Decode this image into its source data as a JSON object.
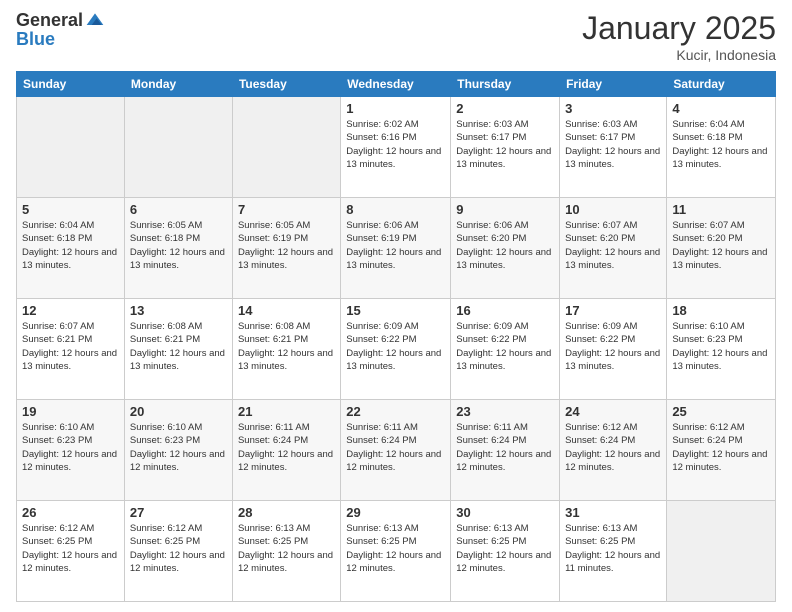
{
  "logo": {
    "general": "General",
    "blue": "Blue"
  },
  "header": {
    "month": "January 2025",
    "location": "Kucir, Indonesia"
  },
  "weekdays": [
    "Sunday",
    "Monday",
    "Tuesday",
    "Wednesday",
    "Thursday",
    "Friday",
    "Saturday"
  ],
  "weeks": [
    [
      {
        "day": "",
        "empty": true
      },
      {
        "day": "",
        "empty": true
      },
      {
        "day": "",
        "empty": true
      },
      {
        "day": "1",
        "sunrise": "6:02 AM",
        "sunset": "6:16 PM",
        "daylight": "12 hours and 13 minutes."
      },
      {
        "day": "2",
        "sunrise": "6:03 AM",
        "sunset": "6:17 PM",
        "daylight": "12 hours and 13 minutes."
      },
      {
        "day": "3",
        "sunrise": "6:03 AM",
        "sunset": "6:17 PM",
        "daylight": "12 hours and 13 minutes."
      },
      {
        "day": "4",
        "sunrise": "6:04 AM",
        "sunset": "6:18 PM",
        "daylight": "12 hours and 13 minutes."
      }
    ],
    [
      {
        "day": "5",
        "sunrise": "6:04 AM",
        "sunset": "6:18 PM",
        "daylight": "12 hours and 13 minutes."
      },
      {
        "day": "6",
        "sunrise": "6:05 AM",
        "sunset": "6:18 PM",
        "daylight": "12 hours and 13 minutes."
      },
      {
        "day": "7",
        "sunrise": "6:05 AM",
        "sunset": "6:19 PM",
        "daylight": "12 hours and 13 minutes."
      },
      {
        "day": "8",
        "sunrise": "6:06 AM",
        "sunset": "6:19 PM",
        "daylight": "12 hours and 13 minutes."
      },
      {
        "day": "9",
        "sunrise": "6:06 AM",
        "sunset": "6:20 PM",
        "daylight": "12 hours and 13 minutes."
      },
      {
        "day": "10",
        "sunrise": "6:07 AM",
        "sunset": "6:20 PM",
        "daylight": "12 hours and 13 minutes."
      },
      {
        "day": "11",
        "sunrise": "6:07 AM",
        "sunset": "6:20 PM",
        "daylight": "12 hours and 13 minutes."
      }
    ],
    [
      {
        "day": "12",
        "sunrise": "6:07 AM",
        "sunset": "6:21 PM",
        "daylight": "12 hours and 13 minutes."
      },
      {
        "day": "13",
        "sunrise": "6:08 AM",
        "sunset": "6:21 PM",
        "daylight": "12 hours and 13 minutes."
      },
      {
        "day": "14",
        "sunrise": "6:08 AM",
        "sunset": "6:21 PM",
        "daylight": "12 hours and 13 minutes."
      },
      {
        "day": "15",
        "sunrise": "6:09 AM",
        "sunset": "6:22 PM",
        "daylight": "12 hours and 13 minutes."
      },
      {
        "day": "16",
        "sunrise": "6:09 AM",
        "sunset": "6:22 PM",
        "daylight": "12 hours and 13 minutes."
      },
      {
        "day": "17",
        "sunrise": "6:09 AM",
        "sunset": "6:22 PM",
        "daylight": "12 hours and 13 minutes."
      },
      {
        "day": "18",
        "sunrise": "6:10 AM",
        "sunset": "6:23 PM",
        "daylight": "12 hours and 13 minutes."
      }
    ],
    [
      {
        "day": "19",
        "sunrise": "6:10 AM",
        "sunset": "6:23 PM",
        "daylight": "12 hours and 12 minutes."
      },
      {
        "day": "20",
        "sunrise": "6:10 AM",
        "sunset": "6:23 PM",
        "daylight": "12 hours and 12 minutes."
      },
      {
        "day": "21",
        "sunrise": "6:11 AM",
        "sunset": "6:24 PM",
        "daylight": "12 hours and 12 minutes."
      },
      {
        "day": "22",
        "sunrise": "6:11 AM",
        "sunset": "6:24 PM",
        "daylight": "12 hours and 12 minutes."
      },
      {
        "day": "23",
        "sunrise": "6:11 AM",
        "sunset": "6:24 PM",
        "daylight": "12 hours and 12 minutes."
      },
      {
        "day": "24",
        "sunrise": "6:12 AM",
        "sunset": "6:24 PM",
        "daylight": "12 hours and 12 minutes."
      },
      {
        "day": "25",
        "sunrise": "6:12 AM",
        "sunset": "6:24 PM",
        "daylight": "12 hours and 12 minutes."
      }
    ],
    [
      {
        "day": "26",
        "sunrise": "6:12 AM",
        "sunset": "6:25 PM",
        "daylight": "12 hours and 12 minutes."
      },
      {
        "day": "27",
        "sunrise": "6:12 AM",
        "sunset": "6:25 PM",
        "daylight": "12 hours and 12 minutes."
      },
      {
        "day": "28",
        "sunrise": "6:13 AM",
        "sunset": "6:25 PM",
        "daylight": "12 hours and 12 minutes."
      },
      {
        "day": "29",
        "sunrise": "6:13 AM",
        "sunset": "6:25 PM",
        "daylight": "12 hours and 12 minutes."
      },
      {
        "day": "30",
        "sunrise": "6:13 AM",
        "sunset": "6:25 PM",
        "daylight": "12 hours and 12 minutes."
      },
      {
        "day": "31",
        "sunrise": "6:13 AM",
        "sunset": "6:25 PM",
        "daylight": "12 hours and 11 minutes."
      },
      {
        "day": "",
        "empty": true
      }
    ]
  ]
}
